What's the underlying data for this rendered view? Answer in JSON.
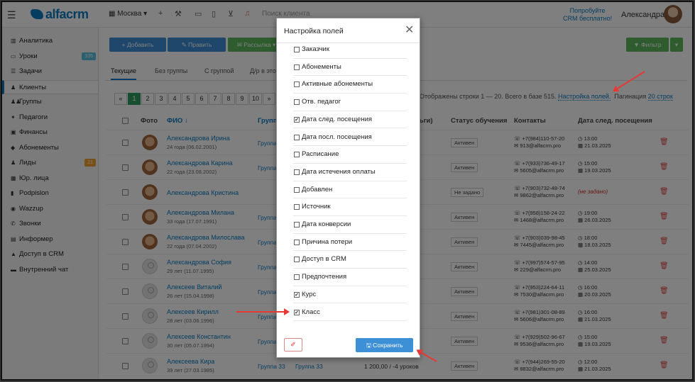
{
  "topbar": {
    "logo": "alfacrm",
    "city": "Москва ▾",
    "search_placeholder": "Поиск клиента",
    "promo_line1": "Попробуйте",
    "promo_line2": "CRM бесплатно!",
    "username": "Александра"
  },
  "sidebar": {
    "items": [
      {
        "label": "Аналитика",
        "icon": "chart-icon"
      },
      {
        "label": "Уроки",
        "icon": "calendar-icon",
        "badge": "105",
        "badge_color": "#5bc0de"
      },
      {
        "label": "Задачи",
        "icon": "tasks-icon"
      },
      {
        "label": "Клиенты",
        "icon": "user-icon"
      },
      {
        "label": "Группы",
        "icon": "users-icon"
      },
      {
        "label": "Педагоги",
        "icon": "teacher-icon"
      },
      {
        "label": "Финансы",
        "icon": "money-icon"
      },
      {
        "label": "Абонементы",
        "icon": "tag-icon"
      },
      {
        "label": "Лиды",
        "icon": "lead-icon",
        "badge": "21",
        "badge_color": "#f0a030"
      },
      {
        "label": "Юр. лица",
        "icon": "building-icon"
      },
      {
        "label": "Podpislon",
        "icon": "doc-icon"
      },
      {
        "label": "Wazzup",
        "icon": "whatsapp-icon"
      },
      {
        "label": "Звонки",
        "icon": "phone-icon"
      },
      {
        "label": "Информер",
        "icon": "informer-icon"
      },
      {
        "label": "Доступ в CRM",
        "icon": "lock-icon"
      },
      {
        "label": "Внутренний чат",
        "icon": "chat-icon"
      }
    ]
  },
  "toolbar": {
    "add_label": "+ Добавить",
    "edit_label": "✎ Править",
    "mailing_label": "✉ Рассылка ▾",
    "filter_label": "▼ Фильтр"
  },
  "tabs": [
    "Текущие",
    "Без группы",
    "С группой",
    "Д/р в это"
  ],
  "pager": {
    "pages": [
      "«",
      "1",
      "2",
      "3",
      "4",
      "5",
      "6",
      "7",
      "8",
      "9",
      "10",
      "»"
    ],
    "info": "Отображены строки 1 — 20. Всего в базе 515.",
    "settings_link": "Настройка полей.",
    "pagination_label": "Пагинация",
    "pagination_value": "20 строк"
  },
  "table": {
    "headers": {
      "photo": "Фото",
      "name": "ФИО ↓",
      "group": "Группа",
      "balance": "ньги)",
      "status": "Статус обучения",
      "contacts": "Контакты",
      "next_visit": "Дата след. посещения"
    },
    "rows": [
      {
        "name": "Александрова Ирина",
        "age": "24 года (06.02.2001)",
        "group": "Группа",
        "status": "Активен",
        "phone": "☏ +7(984)110-57-20",
        "email": "✉ 913@alfacrm.pro",
        "time": "◷ 13:00",
        "date": "▦ 21.03.2025",
        "photo": true
      },
      {
        "name": "Александрова Карина",
        "age": "22 года (23.08.2002)",
        "group": "Группа",
        "status": "Активен",
        "phone": "☏ +7(933)736-49-17",
        "email": "✉ 5605@alfacrm.pro",
        "time": "◷ 15:00",
        "date": "▦ 19.03.2025",
        "photo": true
      },
      {
        "name": "Александрова Кристина",
        "age": "",
        "group": "",
        "status": "Не задано",
        "phone": "☏ +7(903)732-48-74",
        "email": "✉ 9862@alfacrm.pro",
        "time": "",
        "date": "(не задано)",
        "photo": true
      },
      {
        "name": "Александрова Милана",
        "age": "33 года (17.07.1991)",
        "group": "Группа",
        "status": "Активен",
        "phone": "☏ +7(958)158-24-22",
        "email": "✉ 1468@alfacrm.pro",
        "time": "◷ 19:00",
        "date": "▦ 26.03.2025",
        "photo": true
      },
      {
        "name": "Александрова Милослава",
        "age": "22 года (07.04.2002)",
        "group": "Группа",
        "status": "Активен",
        "phone": "☏ +7(903)039-98-45",
        "email": "✉ 7445@alfacrm.pro",
        "time": "◷ 18:00",
        "date": "▦ 18.03.2025",
        "photo": true
      },
      {
        "name": "Александрова София",
        "age": "29 лет (11.07.1995)",
        "group": "Группа",
        "status": "Активен",
        "phone": "☏ +7(997)574-57-95",
        "email": "✉ 229@alfacrm.pro",
        "time": "◷ 14:00",
        "date": "▦ 25.03.2025",
        "photo": false
      },
      {
        "name": "Алексеев Виталий",
        "age": "26 лет (15.04.1998)",
        "group": "Группа",
        "status": "Активен",
        "phone": "☏ +7(953)224-64-11",
        "email": "✉ 7530@alfacrm.pro",
        "time": "◷ 16:00",
        "date": "▦ 20.03.2025",
        "photo": false
      },
      {
        "name": "Алексеев Кирилл",
        "age": "28 лет (03.06.1996)",
        "group": "Группа",
        "status": "Активен",
        "phone": "☏ +7(981)301-08-89",
        "email": "✉ 5606@alfacrm.pro",
        "time": "◷ 16:00",
        "date": "▦ 21.03.2025",
        "photo": false
      },
      {
        "name": "Алексеев Константин",
        "age": "30 лет (05.07.1994)",
        "group": "Группа",
        "status": "Активен",
        "phone": "☏ +7(929)502-96-67",
        "email": "✉ 9536@alfacrm.pro",
        "time": "◷ 15:00",
        "date": "▦ 19.03.2025",
        "photo": false
      },
      {
        "name": "Алексеева Кира",
        "age": "39 лет (27.03.1985)",
        "group": "Группа 33",
        "group2": "Группа 33",
        "balance": "1 200,00 / -4 уроков",
        "status": "Активен",
        "phone": "☏ +7(944)269-55-20",
        "email": "✉ 8832@alfacrm.pro",
        "time": "◷ 12:00",
        "date": "▦ 21.03.2025",
        "photo": false
      }
    ]
  },
  "modal": {
    "title": "Настройка полей",
    "save_label": "🖫 Сохранить",
    "fields": [
      {
        "label": "Заказчик",
        "checked": false
      },
      {
        "label": "Абонементы",
        "checked": false
      },
      {
        "label": "Активные абонементы",
        "checked": false
      },
      {
        "label": "Отв. педагог",
        "checked": false
      },
      {
        "label": "Дата след. посещения",
        "checked": true
      },
      {
        "label": "Дата посл. посещения",
        "checked": false
      },
      {
        "label": "Расписание",
        "checked": false
      },
      {
        "label": "Дата истечения оплаты",
        "checked": false
      },
      {
        "label": "Добавлен",
        "checked": false
      },
      {
        "label": "Источник",
        "checked": false
      },
      {
        "label": "Дата конверсии",
        "checked": false
      },
      {
        "label": "Причина потери",
        "checked": false
      },
      {
        "label": "Доступ в CRM",
        "checked": false
      },
      {
        "label": "Предпочтения",
        "checked": false
      },
      {
        "label": "Курс",
        "checked": true
      },
      {
        "label": "Класс",
        "checked": true
      }
    ]
  }
}
